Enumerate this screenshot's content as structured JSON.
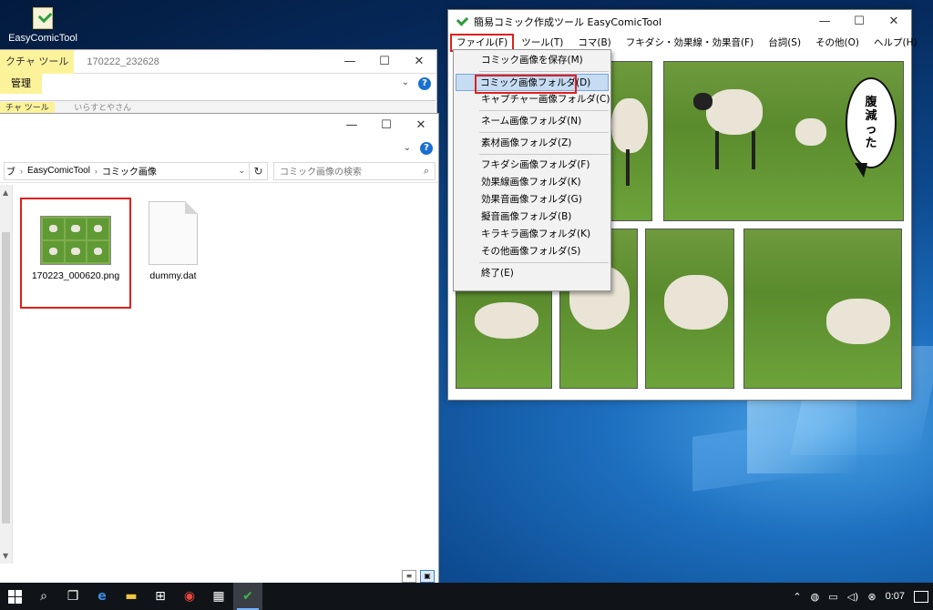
{
  "desktop": {
    "icon_label": "EasyComicTool"
  },
  "explorer_back": {
    "tool_tab": "クチャ ツール",
    "title": "170222_232628",
    "manage_tab": "管理",
    "ctrl_min": "—",
    "ctrl_max": "☐",
    "ctrl_close": "✕",
    "help": "?"
  },
  "explorer_mid": {
    "tool_tab": "チャ ツール",
    "title": "いらすとやさん"
  },
  "explorer_front": {
    "ctrl_min": "—",
    "ctrl_max": "☐",
    "ctrl_close": "✕",
    "help": "?",
    "breadcrumb": [
      "EasyComicTool",
      "コミック画像"
    ],
    "search_placeholder": "コミック画像の検索",
    "files": [
      {
        "name": "170223_000620.png"
      },
      {
        "name": "dummy.dat"
      }
    ]
  },
  "comic_tool": {
    "title": "簡易コミック作成ツール EasyComicTool",
    "ctrl_min": "—",
    "ctrl_max": "☐",
    "ctrl_close": "✕",
    "menu": {
      "file": "ファイル(F)",
      "tool": "ツール(T)",
      "koma": "コマ(B)",
      "fukidashi": "フキダシ・効果線・効果音(F)",
      "serif": "台詞(S)",
      "other": "その他(O)",
      "help": "ヘルプ(H)"
    },
    "balloon_text": [
      "腹",
      "減",
      "っ",
      "た"
    ]
  },
  "file_menu": {
    "items": [
      "コミック画像を保存(M)",
      "コミック画像フォルダ(D)",
      "キャプチャー画像フォルダ(C)",
      "ネーム画像フォルダ(N)",
      "素材画像フォルダ(Z)",
      "フキダシ画像フォルダ(F)",
      "効果線画像フォルダ(K)",
      "効果音画像フォルダ(G)",
      "擬音画像フォルダ(B)",
      "キラキラ画像フォルダ(K)",
      "その他画像フォルダ(S)",
      "終了(E)"
    ]
  },
  "taskbar": {
    "clock": "0:07"
  }
}
